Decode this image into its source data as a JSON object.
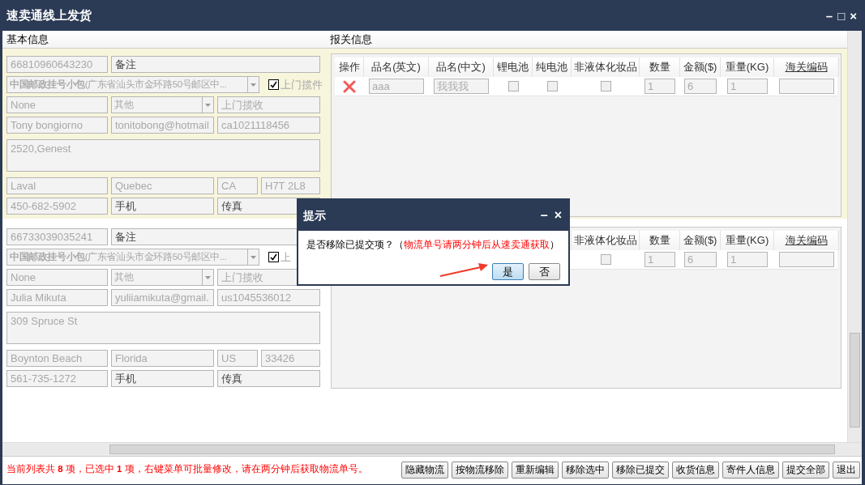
{
  "window": {
    "title": "速卖通线上发货",
    "controls": [
      "–",
      "□",
      "×"
    ]
  },
  "left_header": "基本信息",
  "right_header": "报关信息",
  "records": [
    {
      "selected": true,
      "tracking": "66810960643230",
      "remark": {
        "placeholder": "备注"
      },
      "carrier": "**中国邮政挂号小包**(广东省汕头市金环路50号邮区中...",
      "pickup": {
        "checked": true,
        "label": "上门揽件"
      },
      "insurance": "None",
      "category": "其他",
      "pickup_mode": "上门揽收",
      "name": "Tony bongiorno",
      "email": "tonitobong@hotmail",
      "order_id": "ca1021118456",
      "address": "2520,Genest",
      "city": "Laval",
      "state": "Quebec",
      "country": "CA",
      "zip": "H7T 2L8",
      "phone": "450-682-5902",
      "mobile": {
        "placeholder": "手机"
      },
      "fax": {
        "placeholder": "传真"
      },
      "customs": {
        "columns": [
          {
            "label": "操作",
            "underlined": false
          },
          {
            "label": "品名(英文)",
            "underlined": false
          },
          {
            "label": "品名(中文)",
            "underlined": false
          },
          {
            "label": "锂电池",
            "underlined": false
          },
          {
            "label": "纯电池",
            "underlined": false
          },
          {
            "label": "非液体化妆品",
            "underlined": false
          },
          {
            "label": "数量",
            "underlined": false
          },
          {
            "label": "金额($)",
            "underlined": false
          },
          {
            "label": "重量(KG)",
            "underlined": false
          },
          {
            "label": "海关编码",
            "underlined": true
          }
        ],
        "cells": [
          {
            "kind": "delete"
          },
          {
            "kind": "input",
            "value": "aaa"
          },
          {
            "kind": "input",
            "value": "我我我"
          },
          {
            "kind": "checkbox",
            "checked": false
          },
          {
            "kind": "checkbox",
            "checked": false
          },
          {
            "kind": "checkbox",
            "checked": false
          },
          {
            "kind": "input",
            "value": "1"
          },
          {
            "kind": "input",
            "value": "6"
          },
          {
            "kind": "input",
            "value": "1"
          },
          {
            "kind": "input"
          }
        ]
      }
    },
    {
      "selected": false,
      "tracking": "66733039035241",
      "remark": {
        "placeholder": "备注"
      },
      "carrier": "**中国邮政挂号小包**(广东省汕头市金环路50号邮区中...",
      "pickup": {
        "checked": true,
        "label": "上"
      },
      "insurance": "None",
      "category": "其他",
      "pickup_mode": "上门揽收",
      "name": "Julia Mikuta",
      "email": "yuliiamikuta@gmail.",
      "order_id": "us1045536012",
      "address": "309 Spruce St",
      "city": "Boynton Beach",
      "state": "Florida",
      "country": "US",
      "zip": "33426",
      "phone": "561-735-1272",
      "mobile": {
        "placeholder": "手机"
      },
      "fax": {
        "placeholder": "传真"
      },
      "customs": {
        "columns": [
          {
            "label": "非液体化妆品",
            "underlined": false
          },
          {
            "label": "数量",
            "underlined": false
          },
          {
            "label": "金额($)",
            "underlined": false
          },
          {
            "label": "重量(KG)",
            "underlined": false
          },
          {
            "label": "海关编码",
            "underlined": true
          }
        ],
        "cells": [
          {
            "kind": "checkbox",
            "checked": false
          },
          {
            "kind": "input",
            "value": "1"
          },
          {
            "kind": "input",
            "value": "6"
          },
          {
            "kind": "input",
            "value": "1"
          },
          {
            "kind": "input"
          }
        ]
      }
    }
  ],
  "dialog": {
    "title": "提示",
    "controls": [
      "–",
      "×"
    ],
    "message": "是否移除已提交项？（",
    "note": "物流单号请两分钟后从速卖通获取",
    "message_end": "）",
    "buttons": [
      {
        "label": "是",
        "selected": true
      },
      {
        "label": "否",
        "selected": false
      }
    ]
  },
  "status_text": "当前列表共 **8** 项，已选中 **1** 项，右键菜单可批量修改，请在两分钟后获取物流单号。",
  "actions": [
    "隐藏物流",
    "按物流移除",
    "重新编辑",
    "移除选中",
    "移除已提交",
    "收货信息",
    "寄件人信息",
    "提交全部",
    "退出"
  ]
}
